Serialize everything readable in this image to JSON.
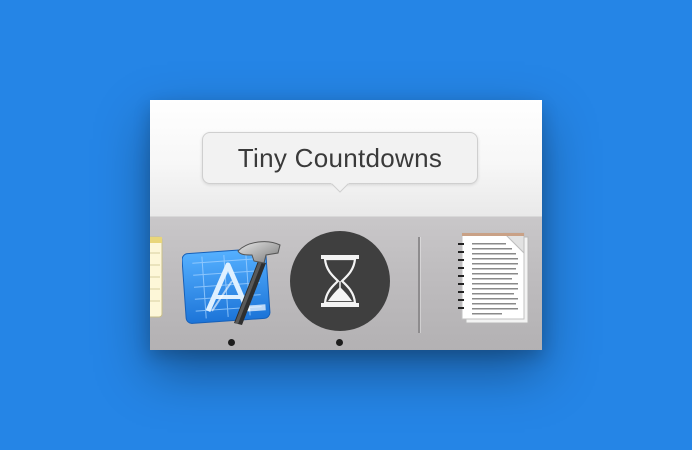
{
  "desktop": {
    "background_color": "#2585e6"
  },
  "tooltip": {
    "text": "Tiny Countdowns"
  },
  "dock": {
    "apps": [
      {
        "icon": "notes-icon",
        "running": false
      },
      {
        "icon": "xcode-icon",
        "running": true
      },
      {
        "icon": "hourglass-icon",
        "running": true
      },
      {
        "icon": "document-icon",
        "running": false
      }
    ]
  },
  "colors": {
    "dock_background": "#bfbdbf",
    "countdown_icon_bg": "#3f3f3f",
    "xcode_blue": "#2d8ff0",
    "running_dot": "#1d1d1d"
  }
}
